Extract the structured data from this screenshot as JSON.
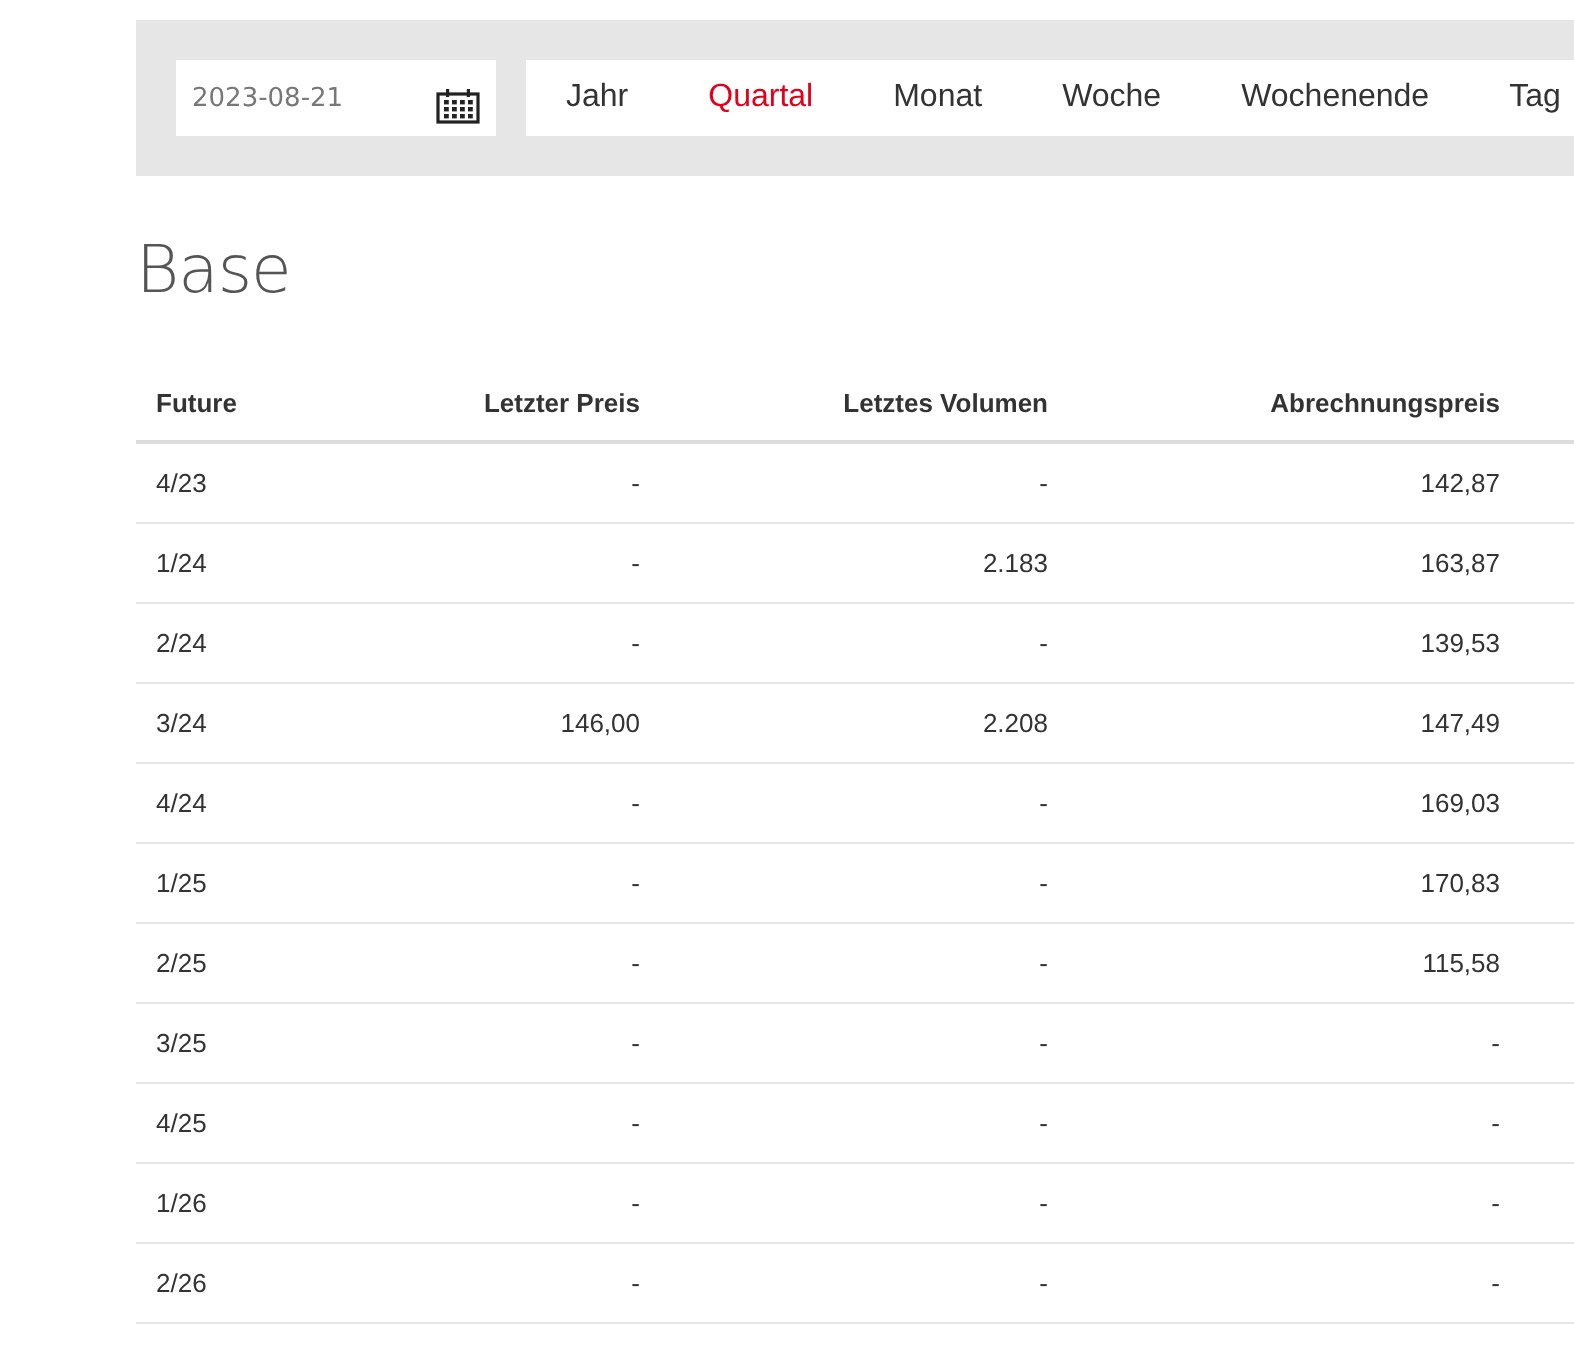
{
  "toolbar": {
    "date": {
      "value": "2023-08-21"
    },
    "tabs": [
      {
        "label": "Jahr",
        "selected": false
      },
      {
        "label": "Quartal",
        "selected": true
      },
      {
        "label": "Monat",
        "selected": false
      },
      {
        "label": "Woche",
        "selected": false
      },
      {
        "label": "Wochenende",
        "selected": false
      },
      {
        "label": "Tag",
        "selected": false
      }
    ]
  },
  "heading": "Base",
  "table": {
    "columns": [
      "Future",
      "Letzter Preis",
      "Letztes Volumen",
      "Abrechnungspreis"
    ],
    "rows": [
      [
        "4/23",
        "-",
        "-",
        "142,87"
      ],
      [
        "1/24",
        "-",
        "2.183",
        "163,87"
      ],
      [
        "2/24",
        "-",
        "-",
        "139,53"
      ],
      [
        "3/24",
        "146,00",
        "2.208",
        "147,49"
      ],
      [
        "4/24",
        "-",
        "-",
        "169,03"
      ],
      [
        "1/25",
        "-",
        "-",
        "170,83"
      ],
      [
        "2/25",
        "-",
        "-",
        "115,58"
      ],
      [
        "3/25",
        "-",
        "-",
        "-"
      ],
      [
        "4/25",
        "-",
        "-",
        "-"
      ],
      [
        "1/26",
        "-",
        "-",
        "-"
      ],
      [
        "2/26",
        "-",
        "-",
        "-"
      ]
    ]
  }
}
